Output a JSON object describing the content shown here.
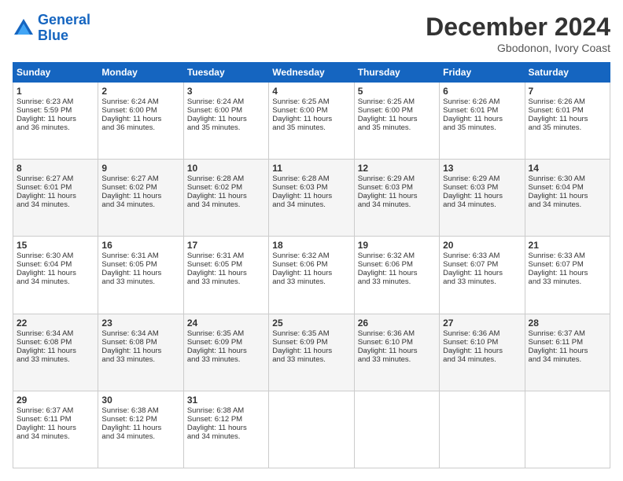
{
  "header": {
    "logo_line1": "General",
    "logo_line2": "Blue",
    "month_title": "December 2024",
    "location": "Gbodonon, Ivory Coast"
  },
  "weekdays": [
    "Sunday",
    "Monday",
    "Tuesday",
    "Wednesday",
    "Thursday",
    "Friday",
    "Saturday"
  ],
  "weeks": [
    [
      {
        "day": "1",
        "info": "Sunrise: 6:23 AM\nSunset: 5:59 PM\nDaylight: 11 hours\nand 36 minutes."
      },
      {
        "day": "2",
        "info": "Sunrise: 6:24 AM\nSunset: 6:00 PM\nDaylight: 11 hours\nand 36 minutes."
      },
      {
        "day": "3",
        "info": "Sunrise: 6:24 AM\nSunset: 6:00 PM\nDaylight: 11 hours\nand 35 minutes."
      },
      {
        "day": "4",
        "info": "Sunrise: 6:25 AM\nSunset: 6:00 PM\nDaylight: 11 hours\nand 35 minutes."
      },
      {
        "day": "5",
        "info": "Sunrise: 6:25 AM\nSunset: 6:00 PM\nDaylight: 11 hours\nand 35 minutes."
      },
      {
        "day": "6",
        "info": "Sunrise: 6:26 AM\nSunset: 6:01 PM\nDaylight: 11 hours\nand 35 minutes."
      },
      {
        "day": "7",
        "info": "Sunrise: 6:26 AM\nSunset: 6:01 PM\nDaylight: 11 hours\nand 35 minutes."
      }
    ],
    [
      {
        "day": "8",
        "info": "Sunrise: 6:27 AM\nSunset: 6:01 PM\nDaylight: 11 hours\nand 34 minutes."
      },
      {
        "day": "9",
        "info": "Sunrise: 6:27 AM\nSunset: 6:02 PM\nDaylight: 11 hours\nand 34 minutes."
      },
      {
        "day": "10",
        "info": "Sunrise: 6:28 AM\nSunset: 6:02 PM\nDaylight: 11 hours\nand 34 minutes."
      },
      {
        "day": "11",
        "info": "Sunrise: 6:28 AM\nSunset: 6:03 PM\nDaylight: 11 hours\nand 34 minutes."
      },
      {
        "day": "12",
        "info": "Sunrise: 6:29 AM\nSunset: 6:03 PM\nDaylight: 11 hours\nand 34 minutes."
      },
      {
        "day": "13",
        "info": "Sunrise: 6:29 AM\nSunset: 6:03 PM\nDaylight: 11 hours\nand 34 minutes."
      },
      {
        "day": "14",
        "info": "Sunrise: 6:30 AM\nSunset: 6:04 PM\nDaylight: 11 hours\nand 34 minutes."
      }
    ],
    [
      {
        "day": "15",
        "info": "Sunrise: 6:30 AM\nSunset: 6:04 PM\nDaylight: 11 hours\nand 34 minutes."
      },
      {
        "day": "16",
        "info": "Sunrise: 6:31 AM\nSunset: 6:05 PM\nDaylight: 11 hours\nand 33 minutes."
      },
      {
        "day": "17",
        "info": "Sunrise: 6:31 AM\nSunset: 6:05 PM\nDaylight: 11 hours\nand 33 minutes."
      },
      {
        "day": "18",
        "info": "Sunrise: 6:32 AM\nSunset: 6:06 PM\nDaylight: 11 hours\nand 33 minutes."
      },
      {
        "day": "19",
        "info": "Sunrise: 6:32 AM\nSunset: 6:06 PM\nDaylight: 11 hours\nand 33 minutes."
      },
      {
        "day": "20",
        "info": "Sunrise: 6:33 AM\nSunset: 6:07 PM\nDaylight: 11 hours\nand 33 minutes."
      },
      {
        "day": "21",
        "info": "Sunrise: 6:33 AM\nSunset: 6:07 PM\nDaylight: 11 hours\nand 33 minutes."
      }
    ],
    [
      {
        "day": "22",
        "info": "Sunrise: 6:34 AM\nSunset: 6:08 PM\nDaylight: 11 hours\nand 33 minutes."
      },
      {
        "day": "23",
        "info": "Sunrise: 6:34 AM\nSunset: 6:08 PM\nDaylight: 11 hours\nand 33 minutes."
      },
      {
        "day": "24",
        "info": "Sunrise: 6:35 AM\nSunset: 6:09 PM\nDaylight: 11 hours\nand 33 minutes."
      },
      {
        "day": "25",
        "info": "Sunrise: 6:35 AM\nSunset: 6:09 PM\nDaylight: 11 hours\nand 33 minutes."
      },
      {
        "day": "26",
        "info": "Sunrise: 6:36 AM\nSunset: 6:10 PM\nDaylight: 11 hours\nand 33 minutes."
      },
      {
        "day": "27",
        "info": "Sunrise: 6:36 AM\nSunset: 6:10 PM\nDaylight: 11 hours\nand 34 minutes."
      },
      {
        "day": "28",
        "info": "Sunrise: 6:37 AM\nSunset: 6:11 PM\nDaylight: 11 hours\nand 34 minutes."
      }
    ],
    [
      {
        "day": "29",
        "info": "Sunrise: 6:37 AM\nSunset: 6:11 PM\nDaylight: 11 hours\nand 34 minutes."
      },
      {
        "day": "30",
        "info": "Sunrise: 6:38 AM\nSunset: 6:12 PM\nDaylight: 11 hours\nand 34 minutes."
      },
      {
        "day": "31",
        "info": "Sunrise: 6:38 AM\nSunset: 6:12 PM\nDaylight: 11 hours\nand 34 minutes."
      },
      null,
      null,
      null,
      null
    ]
  ]
}
